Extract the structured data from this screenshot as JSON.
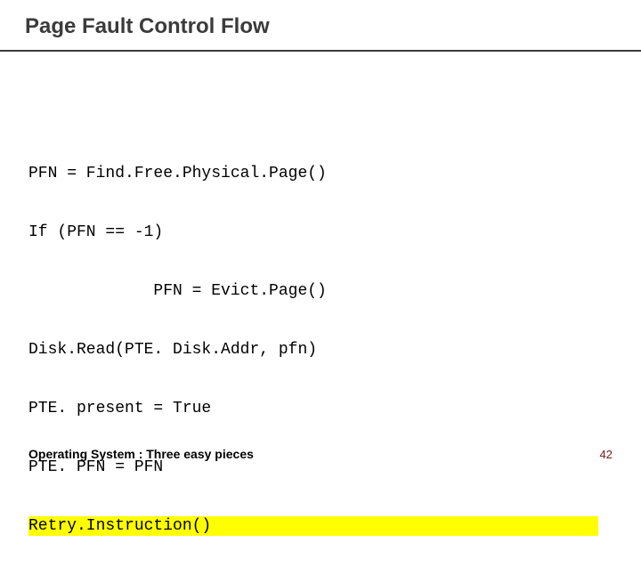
{
  "title": "Page Fault Control Flow",
  "code": {
    "l1": "PFN = Find.Free.Physical.Page()",
    "l2": "If (PFN == -1)",
    "l3": "             PFN = Evict.Page()",
    "l4": "Disk.Read(PTE. Disk.Addr, pfn)",
    "l5": "PTE. present = True",
    "l6": "PTE. PFN = PFN",
    "l7": "Retry.Instruction()"
  },
  "footer": {
    "source": "Operating System : Three easy pieces",
    "page": "42"
  }
}
